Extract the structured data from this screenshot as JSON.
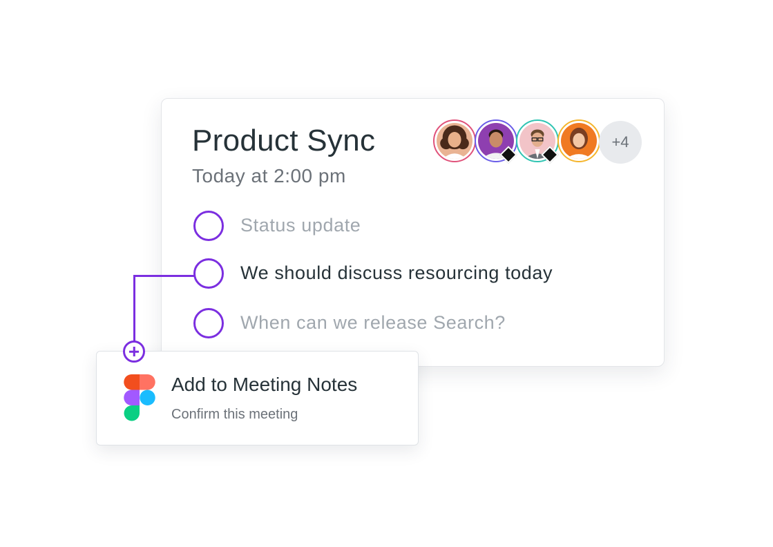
{
  "meeting": {
    "title": "Product Sync",
    "time": "Today at 2:00 pm"
  },
  "attendees": {
    "avatars": [
      {
        "name": "attendee-1",
        "ring": "#e0527a"
      },
      {
        "name": "attendee-2",
        "ring": "#6a5de8"
      },
      {
        "name": "attendee-3",
        "ring": "#2fc4b2"
      },
      {
        "name": "attendee-4",
        "ring": "#f5b52b"
      }
    ],
    "more": "+4"
  },
  "agenda": [
    {
      "text": "Status update",
      "state": "muted"
    },
    {
      "text": "We should discuss resourcing today",
      "state": "active"
    },
    {
      "text": "When can we release Search?",
      "state": "muted"
    }
  ],
  "notes_popup": {
    "title": "Add to Meeting Notes",
    "subtitle": "Confirm this meeting",
    "icon": "figma-icon"
  },
  "colors": {
    "accent": "#7b2ee0",
    "title_text": "#263238",
    "muted_text": "#a0a7ae"
  }
}
